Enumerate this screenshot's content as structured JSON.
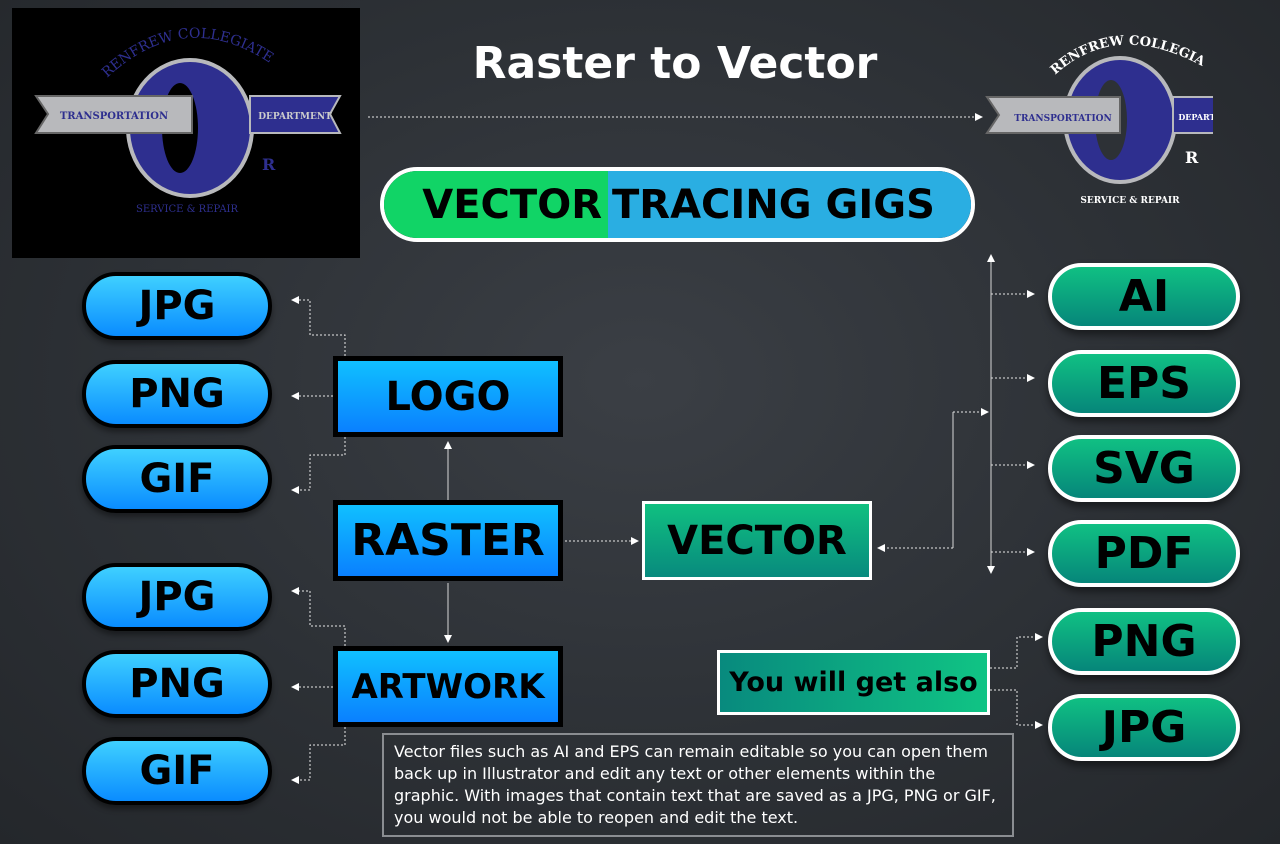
{
  "title": "Raster to Vector",
  "logo": {
    "top_text": "RENFREW COLLEGIATE",
    "left_ribbon": "TRANSPORTATION",
    "right_ribbon": "DEPARTMENT",
    "letter": "R",
    "bottom_text": "SERVICE & REPAIR",
    "colors": {
      "blue": "#2e2f8f",
      "silver": "#b8b9bc"
    }
  },
  "banner": {
    "part1": "VECTOR",
    "part2": "TRACING GIGS",
    "colors": {
      "green": "#11d466",
      "blue": "#2aaee2"
    }
  },
  "raster": {
    "label": "RASTER",
    "logo_node": "LOGO",
    "artwork_node": "ARTWORK",
    "logo_formats": [
      "JPG",
      "PNG",
      "GIF"
    ],
    "artwork_formats": [
      "JPG",
      "PNG",
      "GIF"
    ]
  },
  "vector": {
    "label": "VECTOR",
    "formats": [
      "AI",
      "EPS",
      "SVG",
      "PDF"
    ]
  },
  "extras": {
    "label": "You will get also",
    "formats": [
      "PNG",
      "JPG"
    ]
  },
  "note": "Vector files such as AI and EPS can remain editable so you can open them back up in Illustrator and edit any text or other elements within the graphic. With images that contain text that are saved as a JPG, PNG or GIF, you would not be able to reopen and edit the text."
}
